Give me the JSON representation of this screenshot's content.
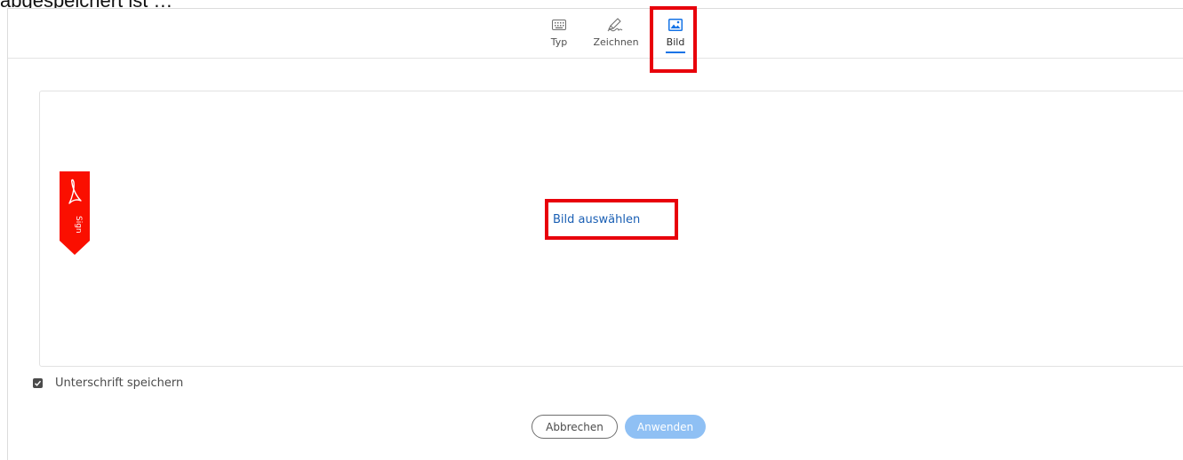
{
  "caption": "abgespeichert ist …",
  "tabs": [
    {
      "label": "Typ",
      "icon": "keyboard-icon"
    },
    {
      "label": "Zeichnen",
      "icon": "pen-draw-icon"
    },
    {
      "label": "Bild",
      "icon": "image-icon",
      "active": true
    }
  ],
  "image_area": {
    "select_label": "Bild auswählen",
    "ribbon_text": "Sign"
  },
  "save_signature": {
    "label": "Unterschrift speichern",
    "checked": true
  },
  "buttons": {
    "cancel": "Abbrechen",
    "apply": "Anwenden"
  },
  "colors": {
    "accent": "#1473e6",
    "highlight": "#e8000b",
    "ribbon": "#fa0f00",
    "apply_disabled": "#8fc0f4"
  }
}
